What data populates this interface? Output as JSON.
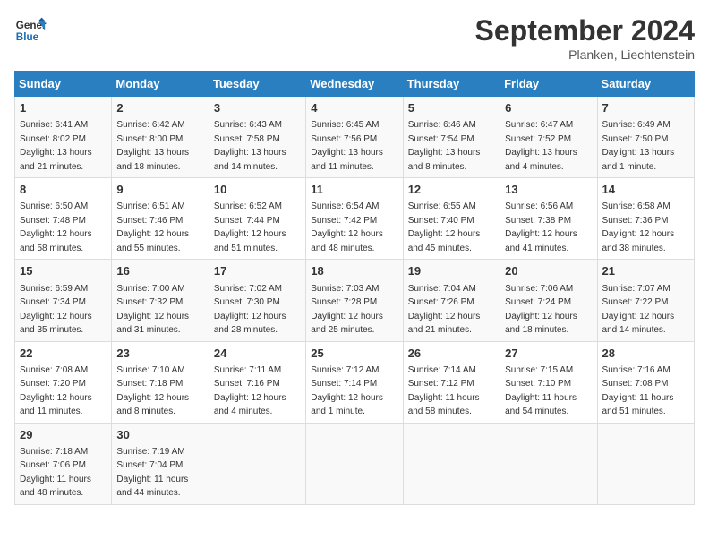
{
  "logo": {
    "line1": "General",
    "line2": "Blue"
  },
  "title": "September 2024",
  "subtitle": "Planken, Liechtenstein",
  "days_of_week": [
    "Sunday",
    "Monday",
    "Tuesday",
    "Wednesday",
    "Thursday",
    "Friday",
    "Saturday"
  ],
  "weeks": [
    [
      {
        "day": 1,
        "info": "Sunrise: 6:41 AM\nSunset: 8:02 PM\nDaylight: 13 hours\nand 21 minutes."
      },
      {
        "day": 2,
        "info": "Sunrise: 6:42 AM\nSunset: 8:00 PM\nDaylight: 13 hours\nand 18 minutes."
      },
      {
        "day": 3,
        "info": "Sunrise: 6:43 AM\nSunset: 7:58 PM\nDaylight: 13 hours\nand 14 minutes."
      },
      {
        "day": 4,
        "info": "Sunrise: 6:45 AM\nSunset: 7:56 PM\nDaylight: 13 hours\nand 11 minutes."
      },
      {
        "day": 5,
        "info": "Sunrise: 6:46 AM\nSunset: 7:54 PM\nDaylight: 13 hours\nand 8 minutes."
      },
      {
        "day": 6,
        "info": "Sunrise: 6:47 AM\nSunset: 7:52 PM\nDaylight: 13 hours\nand 4 minutes."
      },
      {
        "day": 7,
        "info": "Sunrise: 6:49 AM\nSunset: 7:50 PM\nDaylight: 13 hours\nand 1 minute."
      }
    ],
    [
      {
        "day": 8,
        "info": "Sunrise: 6:50 AM\nSunset: 7:48 PM\nDaylight: 12 hours\nand 58 minutes."
      },
      {
        "day": 9,
        "info": "Sunrise: 6:51 AM\nSunset: 7:46 PM\nDaylight: 12 hours\nand 55 minutes."
      },
      {
        "day": 10,
        "info": "Sunrise: 6:52 AM\nSunset: 7:44 PM\nDaylight: 12 hours\nand 51 minutes."
      },
      {
        "day": 11,
        "info": "Sunrise: 6:54 AM\nSunset: 7:42 PM\nDaylight: 12 hours\nand 48 minutes."
      },
      {
        "day": 12,
        "info": "Sunrise: 6:55 AM\nSunset: 7:40 PM\nDaylight: 12 hours\nand 45 minutes."
      },
      {
        "day": 13,
        "info": "Sunrise: 6:56 AM\nSunset: 7:38 PM\nDaylight: 12 hours\nand 41 minutes."
      },
      {
        "day": 14,
        "info": "Sunrise: 6:58 AM\nSunset: 7:36 PM\nDaylight: 12 hours\nand 38 minutes."
      }
    ],
    [
      {
        "day": 15,
        "info": "Sunrise: 6:59 AM\nSunset: 7:34 PM\nDaylight: 12 hours\nand 35 minutes."
      },
      {
        "day": 16,
        "info": "Sunrise: 7:00 AM\nSunset: 7:32 PM\nDaylight: 12 hours\nand 31 minutes."
      },
      {
        "day": 17,
        "info": "Sunrise: 7:02 AM\nSunset: 7:30 PM\nDaylight: 12 hours\nand 28 minutes."
      },
      {
        "day": 18,
        "info": "Sunrise: 7:03 AM\nSunset: 7:28 PM\nDaylight: 12 hours\nand 25 minutes."
      },
      {
        "day": 19,
        "info": "Sunrise: 7:04 AM\nSunset: 7:26 PM\nDaylight: 12 hours\nand 21 minutes."
      },
      {
        "day": 20,
        "info": "Sunrise: 7:06 AM\nSunset: 7:24 PM\nDaylight: 12 hours\nand 18 minutes."
      },
      {
        "day": 21,
        "info": "Sunrise: 7:07 AM\nSunset: 7:22 PM\nDaylight: 12 hours\nand 14 minutes."
      }
    ],
    [
      {
        "day": 22,
        "info": "Sunrise: 7:08 AM\nSunset: 7:20 PM\nDaylight: 12 hours\nand 11 minutes."
      },
      {
        "day": 23,
        "info": "Sunrise: 7:10 AM\nSunset: 7:18 PM\nDaylight: 12 hours\nand 8 minutes."
      },
      {
        "day": 24,
        "info": "Sunrise: 7:11 AM\nSunset: 7:16 PM\nDaylight: 12 hours\nand 4 minutes."
      },
      {
        "day": 25,
        "info": "Sunrise: 7:12 AM\nSunset: 7:14 PM\nDaylight: 12 hours\nand 1 minute."
      },
      {
        "day": 26,
        "info": "Sunrise: 7:14 AM\nSunset: 7:12 PM\nDaylight: 11 hours\nand 58 minutes."
      },
      {
        "day": 27,
        "info": "Sunrise: 7:15 AM\nSunset: 7:10 PM\nDaylight: 11 hours\nand 54 minutes."
      },
      {
        "day": 28,
        "info": "Sunrise: 7:16 AM\nSunset: 7:08 PM\nDaylight: 11 hours\nand 51 minutes."
      }
    ],
    [
      {
        "day": 29,
        "info": "Sunrise: 7:18 AM\nSunset: 7:06 PM\nDaylight: 11 hours\nand 48 minutes."
      },
      {
        "day": 30,
        "info": "Sunrise: 7:19 AM\nSunset: 7:04 PM\nDaylight: 11 hours\nand 44 minutes."
      },
      null,
      null,
      null,
      null,
      null
    ]
  ]
}
